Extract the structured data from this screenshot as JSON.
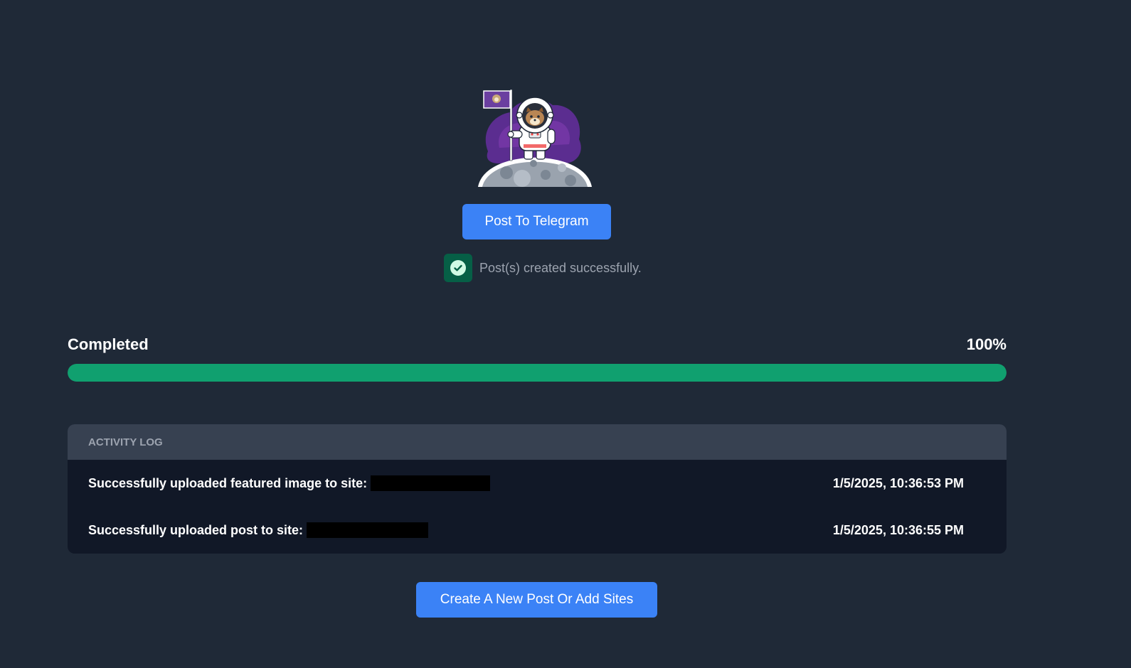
{
  "illustration": {
    "icon": "astronaut-on-moon-illustration"
  },
  "buttons": {
    "telegram_label": "Post To Telegram",
    "new_post_label": "Create A New Post Or Add Sites"
  },
  "status": {
    "message": "Post(s) created successfully.",
    "icon": "check-circle-icon"
  },
  "progress": {
    "label": "Completed",
    "percent_text": "100%",
    "percent": 100
  },
  "activity_log": {
    "header": "ACTIVITY LOG",
    "entries": [
      {
        "message": "Successfully uploaded featured image to site:",
        "timestamp": "1/5/2025, 10:36:53 PM"
      },
      {
        "message": "Successfully uploaded post to site:",
        "timestamp": "1/5/2025, 10:36:55 PM"
      }
    ]
  },
  "colors": {
    "background": "#1f2937",
    "accent": "#3b82f6",
    "success": "#10a06f",
    "log_header": "#374151",
    "log_body": "#111827"
  }
}
